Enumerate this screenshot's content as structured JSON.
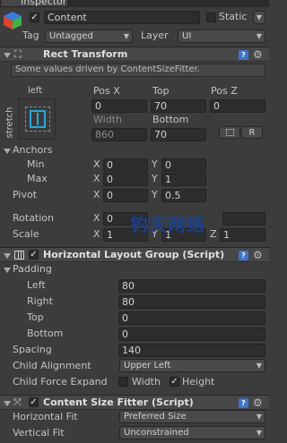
{
  "window": {
    "tab_title": "Inspector"
  },
  "gameobject": {
    "name": "Content",
    "static_label": "Static",
    "tag_label": "Tag",
    "tag_value": "Untagged",
    "layer_label": "Layer",
    "layer_value": "UI"
  },
  "rect_transform": {
    "title": "Rect Transform",
    "info": "Some values driven by ContentSizeFitter.",
    "anchor_h": "left",
    "anchor_v": "stretch",
    "col1": "Pos X",
    "col2": "Top",
    "col3": "Pos Z",
    "posx": "0",
    "top": "70",
    "posz": "0",
    "width_label": "Width",
    "bottom_label": "Bottom",
    "width": "860",
    "bottom": "70",
    "r_button": "R",
    "anchors_label": "Anchors",
    "min_label": "Min",
    "max_label": "Max",
    "min_x": "0",
    "min_y": "0",
    "max_x": "0",
    "max_y": "1",
    "pivot_label": "Pivot",
    "pivot_x": "0",
    "pivot_y": "0.5",
    "rotation_label": "Rotation",
    "rot_x": "0",
    "scale_label": "Scale",
    "scale_x": "1",
    "scale_y": "1",
    "scale_z": "1",
    "x": "X",
    "y": "Y",
    "z": "Z"
  },
  "horizontal_layout": {
    "title": "Horizontal Layout Group (Script)",
    "padding_label": "Padding",
    "left_label": "Left",
    "left": "80",
    "right_label": "Right",
    "right": "80",
    "top_label": "Top",
    "top": "0",
    "bottom_label": "Bottom",
    "bottom": "0",
    "spacing_label": "Spacing",
    "spacing": "140",
    "child_alignment_label": "Child Alignment",
    "child_alignment": "Upper Left",
    "child_force_expand_label": "Child Force Expand",
    "width_label": "Width",
    "height_label": "Height"
  },
  "content_size_fitter": {
    "title": "Content Size Fitter (Script)",
    "horizontal_fit_label": "Horizontal Fit",
    "horizontal_fit": "Preferred Size",
    "vertical_fit_label": "Vertical Fit",
    "vertical_fit": "Unconstrained"
  },
  "watermark_text": "钓天网络",
  "colors": {
    "accent_blue": "#3f73c9",
    "background": "#3c3c3c"
  }
}
